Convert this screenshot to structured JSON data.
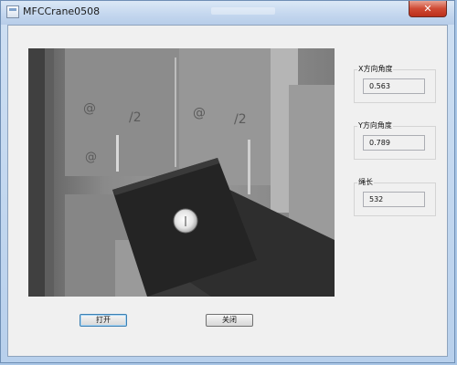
{
  "window": {
    "title": "MFCCrane0508",
    "close_glyph": "✕"
  },
  "groups": {
    "x_angle": {
      "label": "X方向角度",
      "value": "0.563"
    },
    "y_angle": {
      "label": "Y方向角度",
      "value": "0.789"
    },
    "rope_length": {
      "label": "绳长",
      "value": "532"
    }
  },
  "buttons": {
    "open_label": "打开",
    "close_label": "关闭"
  },
  "icons": {
    "app": "mfc-dialog-icon",
    "close": "close-icon"
  },
  "colors": {
    "title_bar": "#c3d6ee",
    "close_button": "#cf4a34",
    "dialog_background": "#f0f0f0",
    "default_button_border": "#3c7fb1"
  }
}
